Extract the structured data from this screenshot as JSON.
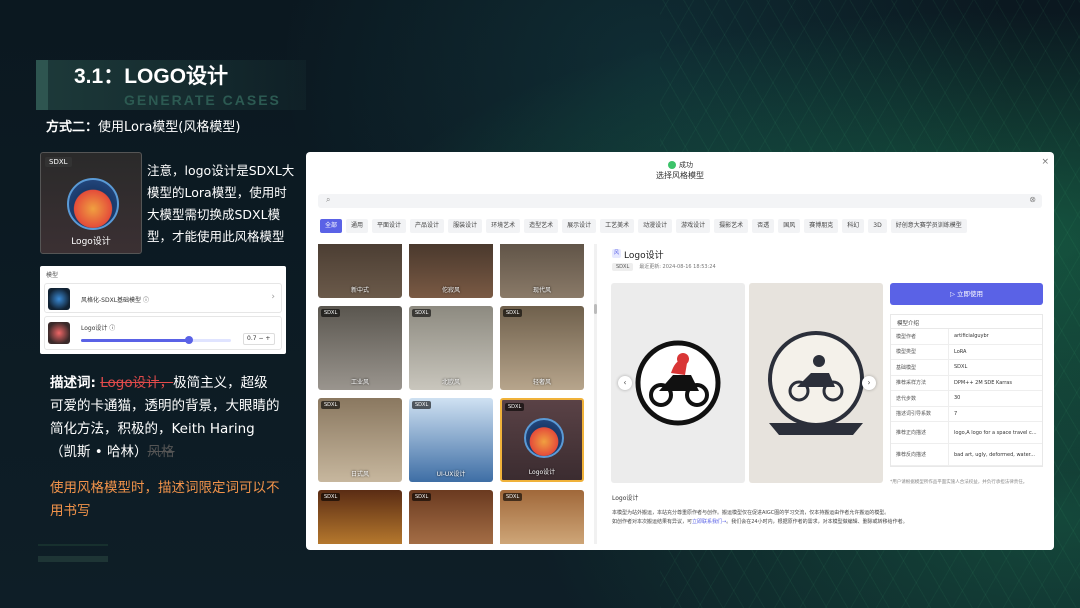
{
  "slide": {
    "title": "3.1：LOGO设计",
    "subtitle_en": "GENERATE CASES",
    "method_bold": "方式二：",
    "method_text": "使用Lora模型(风格模型)",
    "thumb_tag": "SDXL",
    "thumb_label": "Logo设计",
    "note": "注意，logo设计是SDXL大模型的Lora模型，使用时大模型需切换成SDXL模型，才能使用此风格模型",
    "desc_label": "描述词:",
    "desc_struck": "Logo设计，",
    "desc_text": "极简主义，超级可爱的卡通猫，透明的背景，大眼睛的简化方法，积极的，Keith Haring（凯斯 • 哈林）",
    "desc_struck_end": "风格",
    "tip": "使用风格模型时，描述词限定词可以不用书写"
  },
  "small_panel": {
    "header": "模型",
    "row1_label": "风格化-SDXL基础模型 ⓘ",
    "row1_arrow": "›",
    "row2_label": "Logo设计 ⓘ",
    "row2_value": "0.7 − +",
    "row2_slider_value": 0.72
  },
  "modal": {
    "toast": "成功",
    "title": "选择风格模型",
    "close": "×",
    "search_icon": "⌕",
    "search_clear": "⊗",
    "tags": [
      "全部",
      "通用",
      "平面设计",
      "产品设计",
      "服装设计",
      "环境艺术",
      "造型艺术",
      "展示设计",
      "工艺美术",
      "动漫设计",
      "游戏设计",
      "摄影艺术",
      "否透",
      "国风",
      "赛博朋克",
      "科幻",
      "3D",
      "好创意大赛学员训练模型"
    ],
    "grid": [
      {
        "label": "新中式",
        "tag": ""
      },
      {
        "label": "佗寂风",
        "tag": ""
      },
      {
        "label": "现代风",
        "tag": ""
      },
      {
        "label": "工业风",
        "tag": "SDXL"
      },
      {
        "label": "北欧风",
        "tag": "SDXL"
      },
      {
        "label": "轻奢风",
        "tag": "SDXL"
      },
      {
        "label": "日式风",
        "tag": "SDXL"
      },
      {
        "label": "UI-UX设计",
        "tag": "SDXL"
      },
      {
        "label": "Logo设计",
        "tag": "SDXL"
      },
      {
        "label": "",
        "tag": "SDXL"
      },
      {
        "label": "",
        "tag": "SDXL"
      },
      {
        "label": "",
        "tag": "SDXL"
      }
    ],
    "detail": {
      "badge": "风",
      "title": "Logo设计",
      "sdxl": "SDXL",
      "updated": "最近更新: 2024-08-16 18:53:24",
      "use_button": "▷ 立即使用",
      "info_header": "模型介绍",
      "info_rows": [
        {
          "k": "模型作者",
          "v": "artificialguybr"
        },
        {
          "k": "模型类型",
          "v": "LoRA"
        },
        {
          "k": "基础模型",
          "v": "SDXL"
        },
        {
          "k": "推荐采样方法",
          "v": "DPM++ 2M SDE Karras"
        },
        {
          "k": "迭代步数",
          "v": "30"
        },
        {
          "k": "描述词引导系数",
          "v": "7"
        },
        {
          "k": "推荐正向描述",
          "v": "logo,A logo for a space travel c..."
        },
        {
          "k": "推荐反向描述",
          "v": "bad art, ugly, deformed, water..."
        }
      ],
      "info_note": "*用户请根据模型所作品平面实施人合法权益，并负行承担法律责任。",
      "desc_header": "Logo设计",
      "desc_line1": "本模型为站外搬运，本站充分尊重原作者与创作。搬运模型仅在促进AIGC图的学习交流，仅本持搬运由作者允许搬运的模型。",
      "desc_line2_a": "如创作者对本次搬运结果有异议，可",
      "desc_line2_link": "立即联系我们→",
      "desc_line2_b": "。我们会在24小时内，根据原作者的需求，对本模型做编辑、删除或转移给作者。"
    }
  },
  "colors": {
    "accent": "#5a62e6",
    "tip_orange": "#f2934a",
    "strike_red": "#e24b4b",
    "selected_border": "#f0b23a"
  }
}
